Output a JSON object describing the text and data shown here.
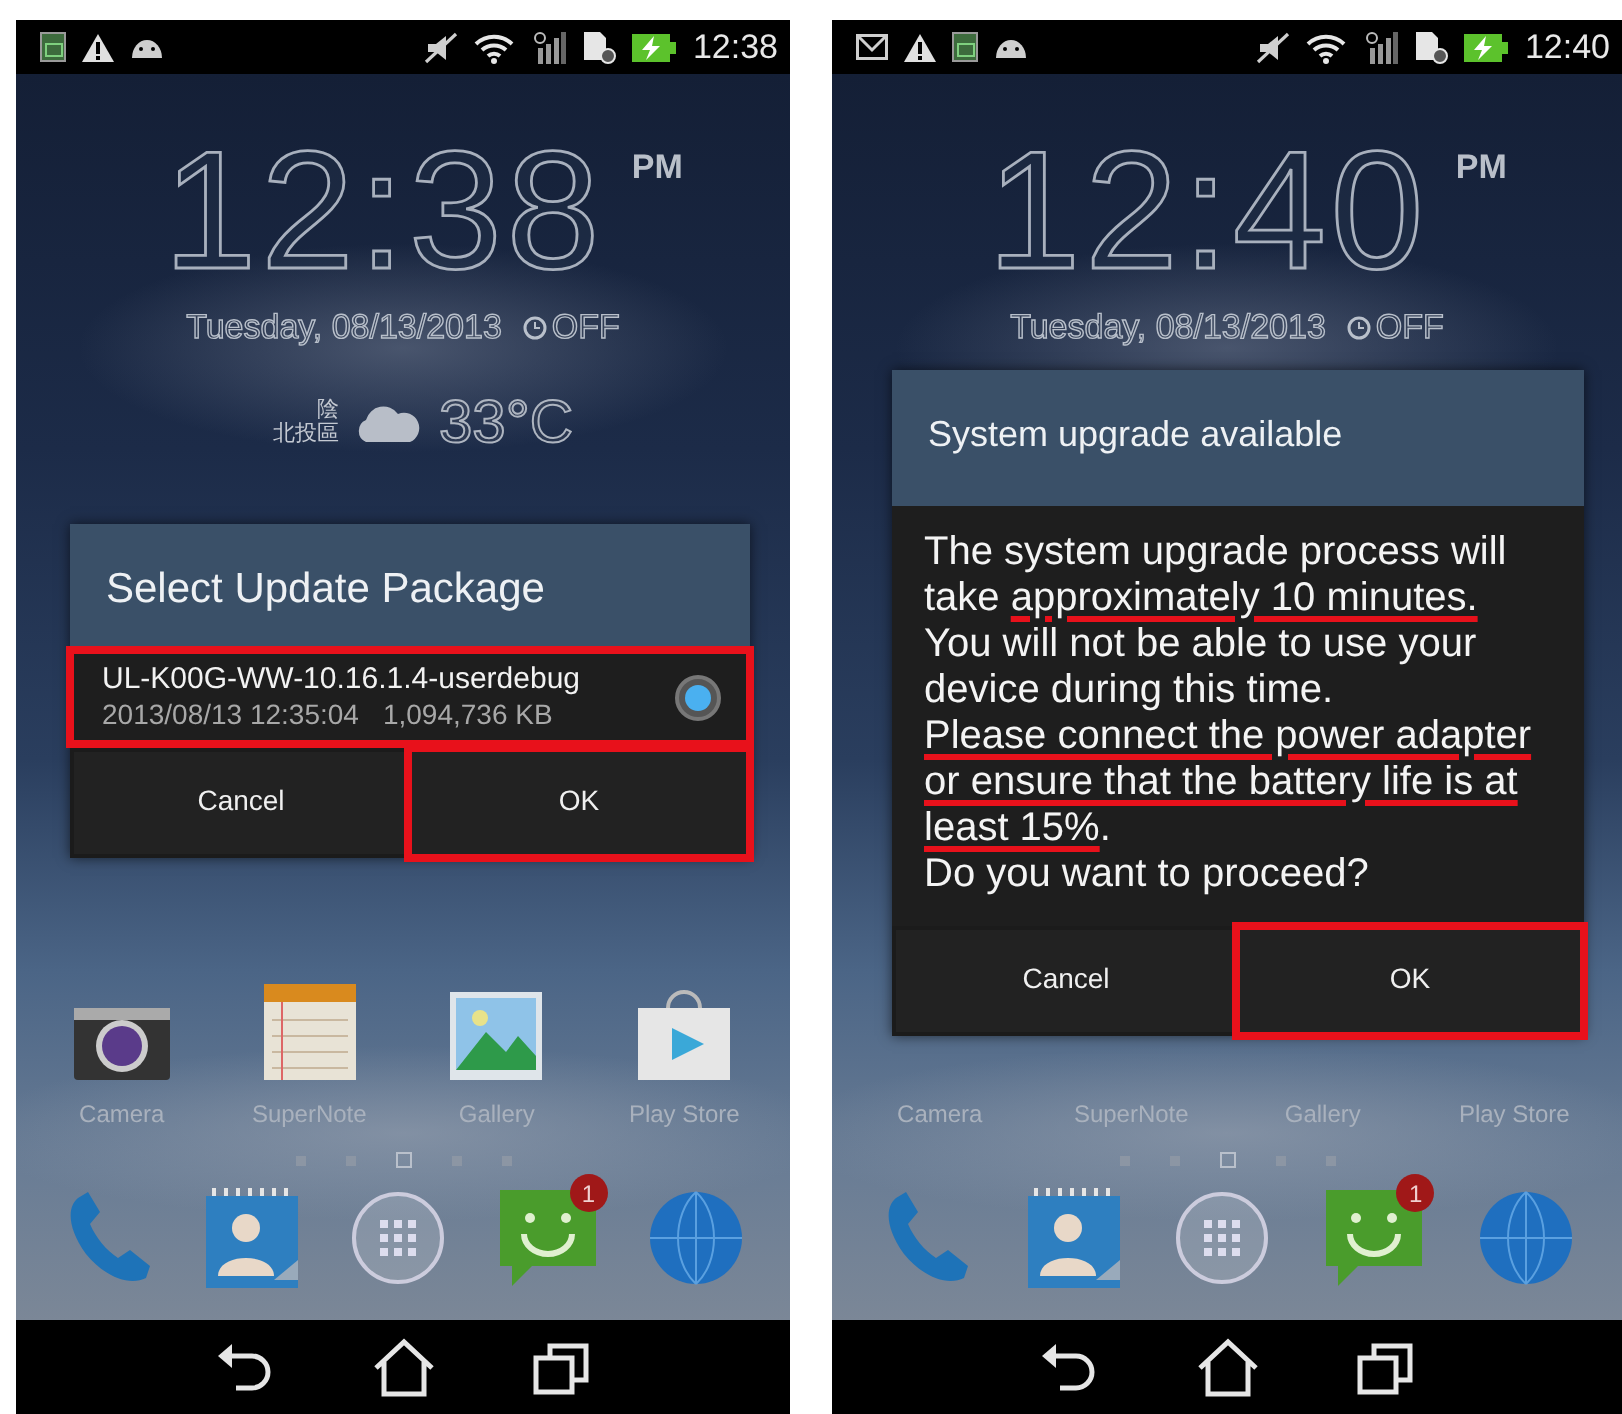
{
  "phones": [
    {
      "status_bar": {
        "notifications": [
          {
            "kind": "image"
          },
          {
            "kind": "warning"
          },
          {
            "kind": "android"
          }
        ],
        "time": "12:38"
      },
      "clock": {
        "time": "12:38",
        "ampm": "PM",
        "date": "Tuesday, 08/13/2013",
        "alarm": "OFF"
      },
      "weather": {
        "condition": "陰",
        "location": "北投區",
        "temperature": "33°C"
      },
      "home": {
        "apps": [
          {
            "kind": "camera",
            "label": "Camera"
          },
          {
            "kind": "note",
            "label": "SuperNote"
          },
          {
            "kind": "gallery",
            "label": "Gallery"
          },
          {
            "kind": "store",
            "label": "Play Store"
          }
        ],
        "page_dots": [
          {
            "selected": false
          },
          {
            "selected": false
          },
          {
            "selected": true
          },
          {
            "selected": false
          },
          {
            "selected": false
          }
        ],
        "dock": [
          {
            "kind": "phone"
          },
          {
            "kind": "contacts"
          },
          {
            "kind": "apps"
          },
          {
            "kind": "messaging",
            "badge": "1"
          },
          {
            "kind": "browser"
          }
        ]
      },
      "dialog": {
        "kind": "list",
        "title": "Select Update Package",
        "items": [
          {
            "name": "UL-K00G-WW-10.16.1.4-userdebug",
            "date": "2013/08/13 12:35:04",
            "size": "1,094,736 KB",
            "selected": true,
            "highlighted": true
          }
        ],
        "buttons": [
          {
            "label": "Cancel",
            "highlighted": false
          },
          {
            "label": "OK",
            "highlighted": true
          }
        ]
      }
    },
    {
      "status_bar": {
        "notifications": [
          {
            "kind": "mail"
          },
          {
            "kind": "warning"
          },
          {
            "kind": "image"
          },
          {
            "kind": "android"
          }
        ],
        "time": "12:40"
      },
      "clock": {
        "time": "12:40",
        "ampm": "PM",
        "date": "Tuesday, 08/13/2013",
        "alarm": "OFF"
      },
      "home": {
        "apps": [
          {
            "label": "Camera"
          },
          {
            "label": "SuperNote"
          },
          {
            "label": "Gallery"
          },
          {
            "label": "Play Store"
          }
        ],
        "page_dots": [
          {
            "selected": false
          },
          {
            "selected": false
          },
          {
            "selected": true
          },
          {
            "selected": false
          },
          {
            "selected": false
          }
        ],
        "dock": [
          {
            "kind": "phone"
          },
          {
            "kind": "contacts"
          },
          {
            "kind": "apps"
          },
          {
            "kind": "messaging",
            "badge": "1"
          },
          {
            "kind": "browser"
          }
        ]
      },
      "dialog": {
        "kind": "message",
        "title": "System upgrade available",
        "paragraphs": [
          [
            {
              "text": "The system upgrade process will take ",
              "underlined": false
            },
            {
              "text": "approximately 10 minutes.",
              "underlined": true
            },
            {
              "text": " You will not be able to use your device during this time.",
              "underlined": false
            }
          ],
          [
            {
              "text": "Please connect the power adapter or ensure that the battery life is at least 15%",
              "underlined": true
            },
            {
              "text": ".",
              "underlined": false
            }
          ],
          [
            {
              "text": "Do you want to proceed?",
              "underlined": false
            }
          ]
        ],
        "buttons": [
          {
            "label": "Cancel",
            "highlighted": false
          },
          {
            "label": "OK",
            "highlighted": true
          }
        ]
      }
    }
  ]
}
